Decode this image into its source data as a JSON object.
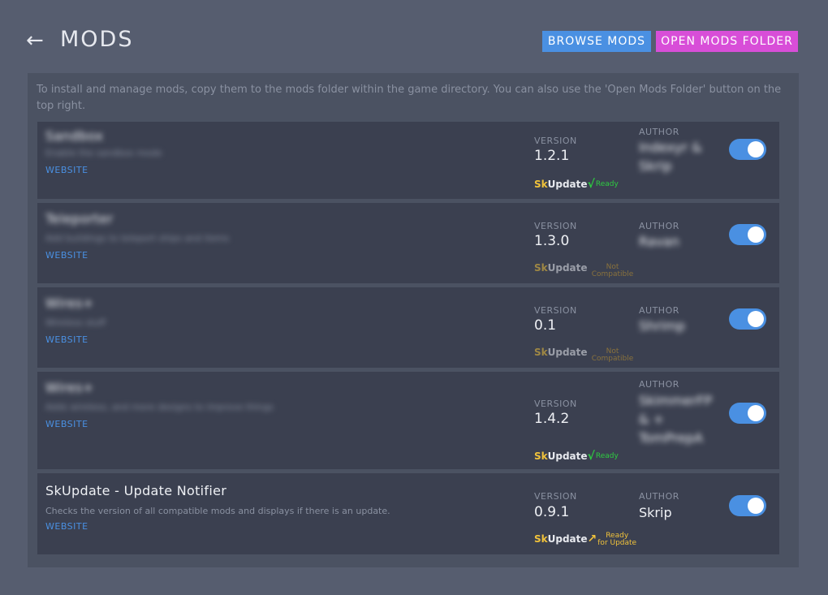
{
  "header": {
    "title": "MODS",
    "back_icon": "←",
    "browse_label": "BROWSE MODS",
    "open_folder_label": "OPEN MODS FOLDER"
  },
  "colors": {
    "background": "#565d6f",
    "panel": "#4b5262",
    "card": "#3b4050",
    "browse_button": "#4a90e2",
    "open_folder_button": "#d84ed8",
    "toggle_on": "#4a90e2",
    "link": "#4a90e2",
    "ready_status": "#2ecc40",
    "update_status": "#f0c23b"
  },
  "intro_text": "To install and manage mods, copy them to the mods folder within the game directory. You can also use the 'Open Mods Folder' button on the top right.",
  "labels": {
    "version": "VERSION",
    "author": "AUTHOR",
    "website": "WEBSITE",
    "sk_prefix": "Sk",
    "sk_suffix": "Update"
  },
  "mods": [
    {
      "name": "Sandbox",
      "description": "Enable the sandbox mode",
      "version": "1.2.1",
      "author": "Indexyr & Skrip",
      "status_icon": "check-icon",
      "status_mark": "√",
      "status_line1": "Ready",
      "status_line2": "",
      "enabled": true
    },
    {
      "name": "Teleporter",
      "description": "Add buildings to teleport ships and items",
      "version": "1.3.0",
      "author": "Ravan",
      "status_icon": "",
      "status_mark": "",
      "status_line1": "Not",
      "status_line2": "Compatible",
      "enabled": true
    },
    {
      "name": "Wires+",
      "description": "Wireless stuff",
      "version": "0.1",
      "author": "Shrimp",
      "status_icon": "",
      "status_mark": "",
      "status_line1": "Not",
      "status_line2": "Compatible",
      "enabled": true
    },
    {
      "name": "Wires+",
      "description": "Adds wireless, and more designs to improve things",
      "version": "1.4.2",
      "author": "SkimmerFP & + TomPrepA",
      "status_icon": "check-icon",
      "status_mark": "√",
      "status_line1": "Ready",
      "status_line2": "",
      "enabled": true
    },
    {
      "name": "SkUpdate - Update Notifier",
      "description": "Checks the version of all compatible mods and displays if there is an update.",
      "version": "0.9.1",
      "author": "Skrip",
      "status_icon": "update-arrow-icon",
      "status_mark": "↗",
      "status_line1": "Ready",
      "status_line2": "for Update",
      "enabled": true
    }
  ]
}
